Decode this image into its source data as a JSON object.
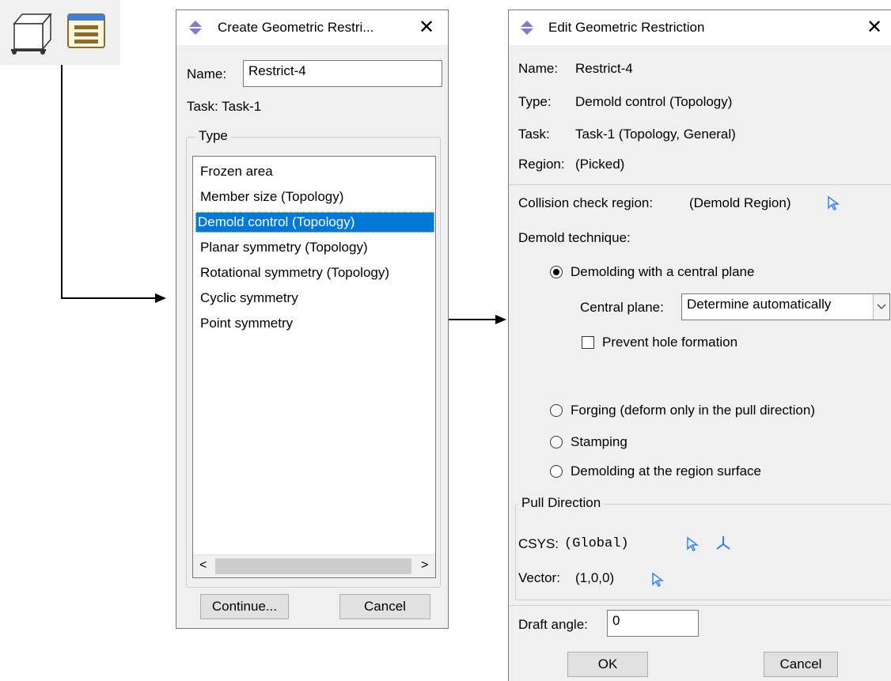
{
  "toolbar": {
    "icons": [
      "part-box-icon",
      "geometric-restriction-manager-icon"
    ]
  },
  "create_dialog": {
    "title": "Create Geometric Restri...",
    "close": "✕",
    "name_label": "Name:",
    "name_value": "Restrict-4",
    "task_label": "Task:",
    "task_value": "Task-1",
    "type_legend": "Type",
    "types": [
      "Frozen area",
      "Member size (Topology)",
      "Demold control (Topology)",
      "Planar symmetry (Topology)",
      "Rotational symmetry (Topology)",
      "Cyclic symmetry",
      "Point symmetry"
    ],
    "selected_type": "Demold control (Topology)",
    "scroll_left": "<",
    "scroll_right": ">",
    "continue_label": "Continue...",
    "cancel_label": "Cancel"
  },
  "edit_dialog": {
    "title": "Edit Geometric Restriction",
    "close": "✕",
    "name_label": "Name:",
    "name_value": "Restrict-4",
    "type_label": "Type:",
    "type_value": "Demold control (Topology)",
    "task_label": "Task:",
    "task_value": "Task-1 (Topology, General)",
    "region_label": "Region:",
    "region_value": "(Picked)",
    "collision_label": "Collision check region:",
    "collision_value": "(Demold Region)",
    "technique_label": "Demold technique:",
    "techniques": [
      "Demolding with a central plane",
      "Forging (deform only in the pull direction)",
      "Stamping",
      "Demolding at the region surface"
    ],
    "selected_technique": "Demolding with a central plane",
    "central_plane_label": "Central plane:",
    "central_plane_value": "Determine automatically",
    "prevent_hole_label": "Prevent hole formation",
    "prevent_hole_checked": false,
    "pull_legend": "Pull Direction",
    "csys_label": "CSYS:",
    "csys_value": "(Global)",
    "vector_label": "Vector:",
    "vector_value": "(1,0,0)",
    "draft_label": "Draft angle:",
    "draft_value": "0",
    "ok_label": "OK",
    "cancel_label": "Cancel"
  },
  "colors": {
    "selection": "#0078d7",
    "pick_arrow": "#2a7fff",
    "dialog_bg": "#f0f0f0"
  }
}
